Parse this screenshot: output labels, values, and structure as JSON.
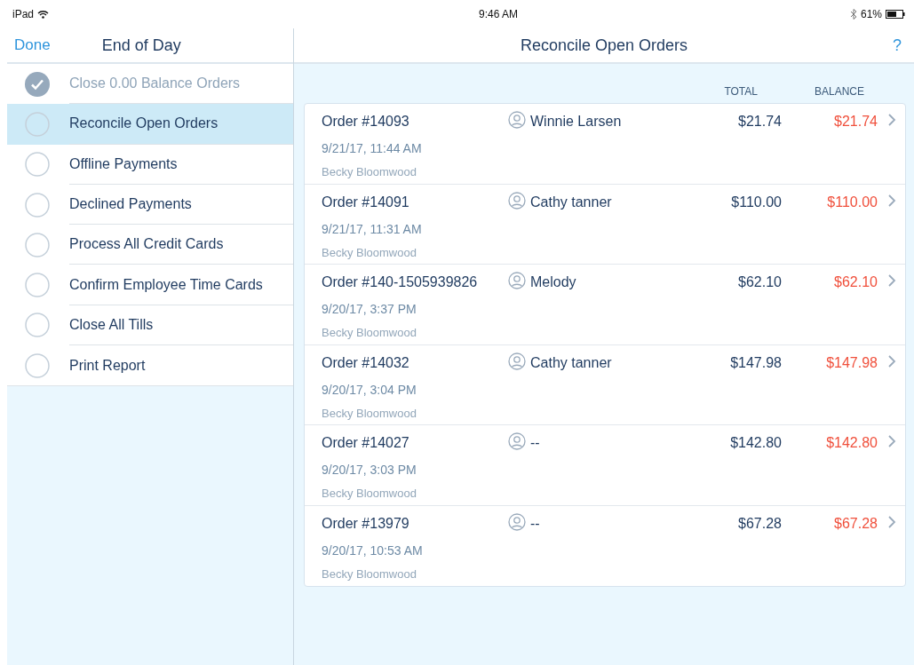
{
  "status_bar": {
    "device": "iPad",
    "time": "9:46 AM",
    "battery": "61%"
  },
  "sidebar": {
    "done": "Done",
    "title": "End of Day",
    "steps": [
      {
        "label": "Close 0.00 Balance Orders",
        "checked": true,
        "selected": false
      },
      {
        "label": "Reconcile Open Orders",
        "checked": false,
        "selected": true
      },
      {
        "label": "Offline Payments",
        "checked": false,
        "selected": false
      },
      {
        "label": "Declined Payments",
        "checked": false,
        "selected": false
      },
      {
        "label": "Process All Credit Cards",
        "checked": false,
        "selected": false
      },
      {
        "label": "Confirm Employee Time Cards",
        "checked": false,
        "selected": false
      },
      {
        "label": "Close All Tills",
        "checked": false,
        "selected": false
      },
      {
        "label": "Print Report",
        "checked": false,
        "selected": false
      }
    ]
  },
  "main": {
    "title": "Reconcile Open Orders",
    "help": "?",
    "columns": [
      "TOTAL",
      "BALANCE"
    ],
    "orders": [
      {
        "order": "Order #14093",
        "customer": "Winnie Larsen",
        "date": "9/21/17, 11:44 AM",
        "employee": "Becky Bloomwood",
        "total": "$21.74",
        "balance": "$21.74"
      },
      {
        "order": "Order #14091",
        "customer": "Cathy tanner",
        "date": "9/21/17, 11:31 AM",
        "employee": "Becky Bloomwood",
        "total": "$110.00",
        "balance": "$110.00"
      },
      {
        "order": "Order #140-1505939826",
        "customer": "Melody",
        "date": "9/20/17, 3:37 PM",
        "employee": "Becky Bloomwood",
        "total": "$62.10",
        "balance": "$62.10"
      },
      {
        "order": "Order #14032",
        "customer": "Cathy tanner",
        "date": "9/20/17, 3:04 PM",
        "employee": "Becky Bloomwood",
        "total": "$147.98",
        "balance": "$147.98"
      },
      {
        "order": "Order #14027",
        "customer": "--",
        "date": "9/20/17, 3:03 PM",
        "employee": "Becky Bloomwood",
        "total": "$142.80",
        "balance": "$142.80"
      },
      {
        "order": "Order #13979",
        "customer": "--",
        "date": "9/20/17, 10:53 AM",
        "employee": "Becky Bloomwood",
        "total": "$67.28",
        "balance": "$67.28"
      }
    ]
  }
}
